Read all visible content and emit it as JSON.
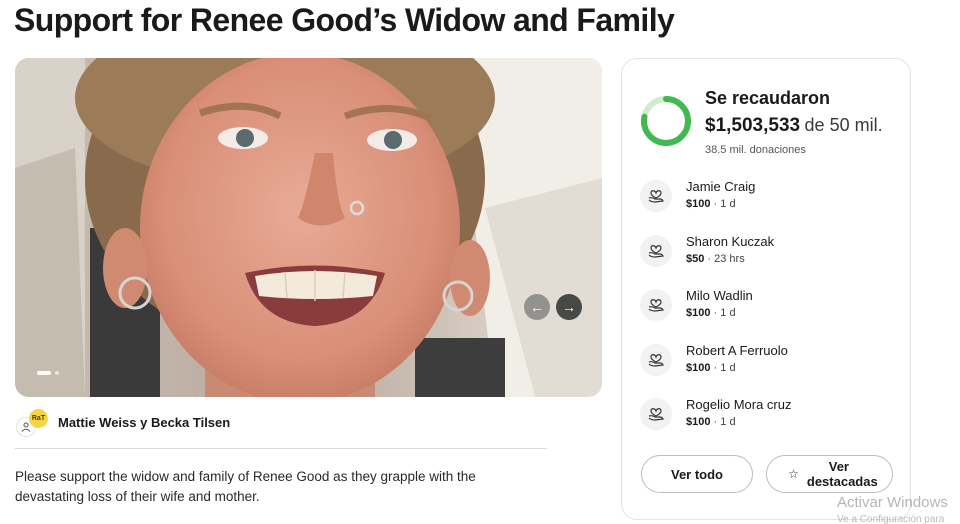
{
  "campaign": {
    "title": "Support for Renee Good’s Widow and Family",
    "organizer": "Mattie Weiss y Becka Tilsen",
    "organizer_logo_text": "RaT",
    "description": "Please support the widow and family of Renee Good as they grapple with the devastating loss of their wife and mother."
  },
  "gallery": {
    "prev_icon": "arrow-left-icon",
    "next_icon": "arrow-right-icon",
    "prev_glyph": "←",
    "next_glyph": "→"
  },
  "fundraising": {
    "raised_label": "Se recaudaron",
    "raised_amount": "$1,503,533",
    "goal_text": "de 50 mil.",
    "donations_count": "38.5 mil. donaciones",
    "progress_fraction": 0.78,
    "accent_color": "#3fb950"
  },
  "donations": [
    {
      "name": "Jamie Craig",
      "amount": "$100",
      "time": "1 d"
    },
    {
      "name": "Sharon Kuczak",
      "amount": "$50",
      "time": "23 hrs"
    },
    {
      "name": "Milo Wadlin",
      "amount": "$100",
      "time": "1 d"
    },
    {
      "name": "Robert A Ferruolo",
      "amount": "$100",
      "time": "1 d"
    },
    {
      "name": "Rogelio Mora cruz",
      "amount": "$100",
      "time": "1 d"
    }
  ],
  "actions": {
    "see_all_label": "Ver todo",
    "featured_label": "Ver destacadas",
    "featured_icon": "star-icon",
    "star_glyph": "☆"
  },
  "os_watermark": {
    "line1": "Activar Windows",
    "line2": "Ve a Configuración para"
  }
}
